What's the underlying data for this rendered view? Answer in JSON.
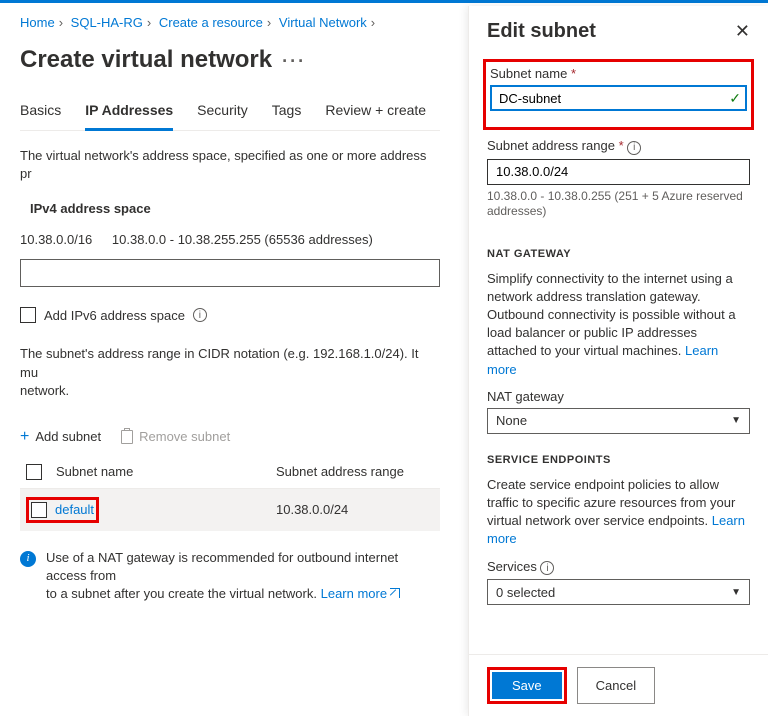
{
  "breadcrumb": [
    "Home",
    "SQL-HA-RG",
    "Create a resource",
    "Virtual Network",
    ""
  ],
  "page_title": "Create virtual network",
  "tabs": [
    "Basics",
    "IP Addresses",
    "Security",
    "Tags",
    "Review + create"
  ],
  "active_tab": 1,
  "addr_desc": "The virtual network's address space, specified as one or more address pr",
  "ipv4_heading": "IPv4 address space",
  "ipv4_cidr": "10.38.0.0/16",
  "ipv4_range": "10.38.0.0 - 10.38.255.255 (65536 addresses)",
  "ipv6_label": "Add IPv6 address space",
  "subnet_desc": "The subnet's address range in CIDR notation (e.g. 192.168.1.0/24). It mu",
  "subnet_desc2": "network.",
  "add_subnet": "Add subnet",
  "remove_subnet": "Remove subnet",
  "tbl_head_name": "Subnet name",
  "tbl_head_range": "Subnet address range",
  "subnet_row": {
    "name": "default",
    "range": "10.38.0.0/24"
  },
  "nat_banner": "Use of a NAT gateway is recommended for outbound internet access from",
  "nat_banner2": "to a subnet after you create the virtual network.",
  "learn_more": "Learn more",
  "panel": {
    "title": "Edit subnet",
    "subnet_name_label": "Subnet name",
    "subnet_name_value": "DC-subnet",
    "range_label": "Subnet address range",
    "range_value": "10.38.0.0/24",
    "range_help": "10.38.0.0 - 10.38.0.255 (251 + 5 Azure reserved addresses)",
    "nat_head": "NAT GATEWAY",
    "nat_body": "Simplify connectivity to the internet using a network address translation gateway. Outbound connectivity is possible without a load balancer or public IP addresses attached to your virtual machines.",
    "nat_select_label": "NAT gateway",
    "nat_select_value": "None",
    "se_head": "SERVICE ENDPOINTS",
    "se_body": "Create service endpoint policies to allow traffic to specific azure resources from your virtual network over service endpoints.",
    "services_label": "Services",
    "services_value": "0 selected",
    "save": "Save",
    "cancel": "Cancel"
  }
}
